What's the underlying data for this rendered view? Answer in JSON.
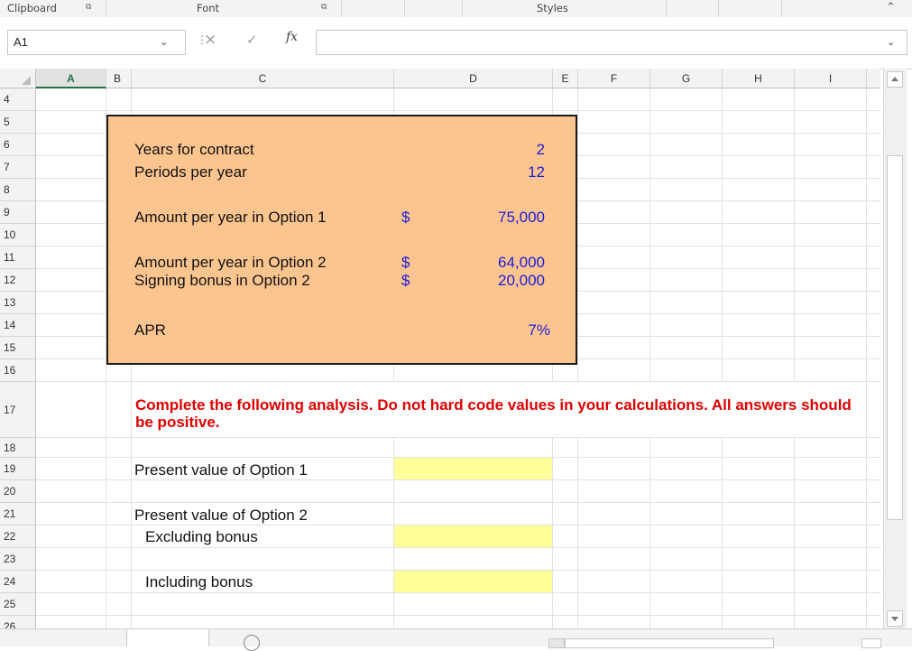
{
  "ribbon": {
    "groups": [
      "Clipboard",
      "Font",
      "Styles"
    ],
    "collapse_icon": "chevron-up-icon"
  },
  "formula_bar": {
    "name_box": "A1",
    "cancel_icon": "×",
    "enter_icon": "✓",
    "fx_label": "fx",
    "formula": ""
  },
  "columns": [
    "A",
    "B",
    "C",
    "D",
    "E",
    "F",
    "G",
    "H",
    "I"
  ],
  "rows": [
    "4",
    "5",
    "6",
    "7",
    "8",
    "9",
    "10",
    "11",
    "12",
    "13",
    "14",
    "15",
    "16",
    "17",
    "18",
    "19",
    "20",
    "21",
    "22",
    "23",
    "24",
    "25",
    "26"
  ],
  "inputs": {
    "years_label": "Years for contract",
    "years_value": "2",
    "periods_label": "Periods per year",
    "periods_value": "12",
    "opt1_label": "Amount per year in Option 1",
    "opt1_currency": "$",
    "opt1_value": "75,000",
    "opt2_label": "Amount per year in Option 2",
    "opt2_currency": "$",
    "opt2_value": "64,000",
    "bonus_label": "Signing bonus in Option 2",
    "bonus_currency": "$",
    "bonus_value": "20,000",
    "apr_label": "APR",
    "apr_value": "7%"
  },
  "instruction": "Complete the following analysis. Do not hard code values in your calculations. All answers should be positive.",
  "analysis": {
    "pv1_label": "Present value of Option 1",
    "pv2_label": "Present value of Option 2",
    "excl_label": "Excluding bonus",
    "incl_label": "Including bonus"
  },
  "colors": {
    "input_fill": "#fcc590",
    "answer_fill": "#ffff99",
    "instruction_text": "#e00000",
    "value_text": "#1b1bd6"
  }
}
